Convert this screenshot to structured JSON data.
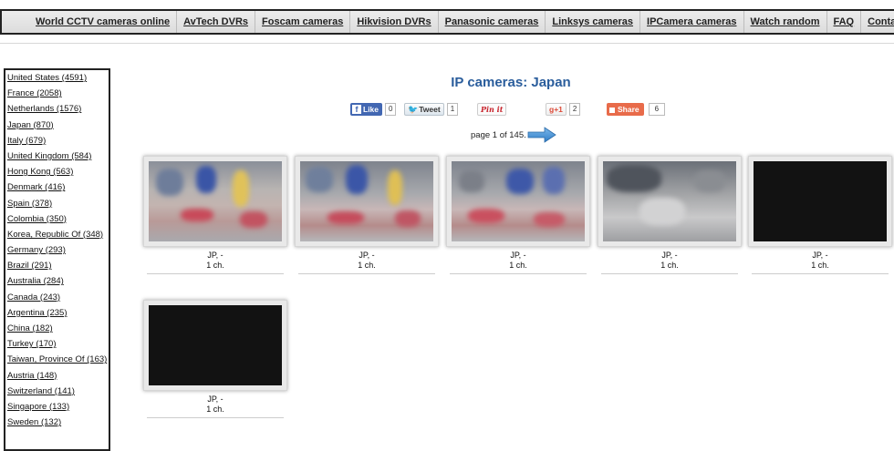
{
  "nav": {
    "items": [
      "World CCTV cameras online",
      "AvTech DVRs",
      "Foscam cameras",
      "Hikvision DVRs",
      "Panasonic cameras",
      "Linksys cameras",
      "IPCamera cameras",
      "Watch random",
      "FAQ",
      "Contacts"
    ]
  },
  "sidebar": {
    "countries": [
      "United States (4591)",
      "France (2058)",
      "Netherlands (1576)",
      "Japan (870)",
      "Italy (679)",
      "United Kingdom (584)",
      "Hong Kong (563)",
      "Denmark (416)",
      "Spain (378)",
      "Colombia (350)",
      "Korea, Republic Of (348)",
      "Germany (293)",
      "Brazil (291)",
      "Australia (284)",
      "Canada (243)",
      "Argentina (235)",
      "China (182)",
      "Turkey (170)",
      "Taiwan, Province Of (163)",
      "Austria (148)",
      "Switzerland (141)",
      "Singapore (133)",
      "Sweden (132)"
    ]
  },
  "page": {
    "title": "IP cameras: Japan",
    "pager_text": "page 1 of 145."
  },
  "share": {
    "like_label": "Like",
    "like_count": "0",
    "tweet_label": "Tweet",
    "tweet_count": "1",
    "pin_label": "Pin it",
    "gplus_label": "+1",
    "gplus_count": "2",
    "share_label": "Share",
    "share_count": "6"
  },
  "cameras": [
    {
      "location": "JP, -",
      "channels": "1 ch.",
      "thumb": "store1"
    },
    {
      "location": "JP, -",
      "channels": "1 ch.",
      "thumb": "store2"
    },
    {
      "location": "JP, -",
      "channels": "1 ch.",
      "thumb": "store2"
    },
    {
      "location": "JP, -",
      "channels": "1 ch.",
      "thumb": "office"
    },
    {
      "location": "JP, -",
      "channels": "1 ch.",
      "thumb": "dark"
    },
    {
      "location": "JP, -",
      "channels": "1 ch.",
      "thumb": "dark"
    }
  ],
  "colors": {
    "title": "#2a5d9c",
    "facebook": "#4267b2",
    "share": "#e86b4a",
    "pinterest": "#c8232c"
  },
  "icons": [
    "facebook-icon",
    "twitter-icon",
    "pinterest-icon",
    "google-plus-icon",
    "share-icon",
    "next-page-arrow-icon"
  ]
}
